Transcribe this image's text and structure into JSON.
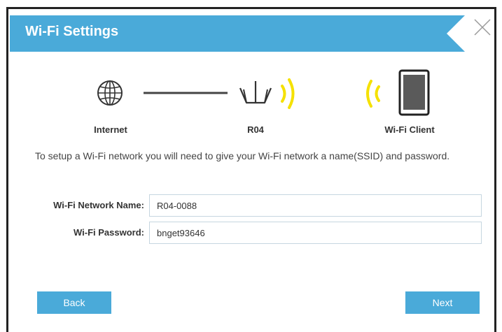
{
  "dialog": {
    "title": "Wi-Fi Settings"
  },
  "diagram": {
    "internet_label": "Internet",
    "router_label": "R04",
    "client_label": "Wi-Fi Client"
  },
  "description": "To setup a Wi-Fi network you will need to give your Wi-Fi network a name(SSID) and password.",
  "form": {
    "network_name_label": "Wi-Fi Network Name:",
    "network_name_value": "R04-0088",
    "password_label": "Wi-Fi Password:",
    "password_value": "bnget93646"
  },
  "buttons": {
    "back": "Back",
    "next": "Next"
  },
  "colors": {
    "accent": "#4aaad9",
    "signal": "#f5e100"
  },
  "icons": [
    "globe-icon",
    "router-icon",
    "wifi-signal-icon",
    "tablet-icon",
    "close-icon"
  ]
}
